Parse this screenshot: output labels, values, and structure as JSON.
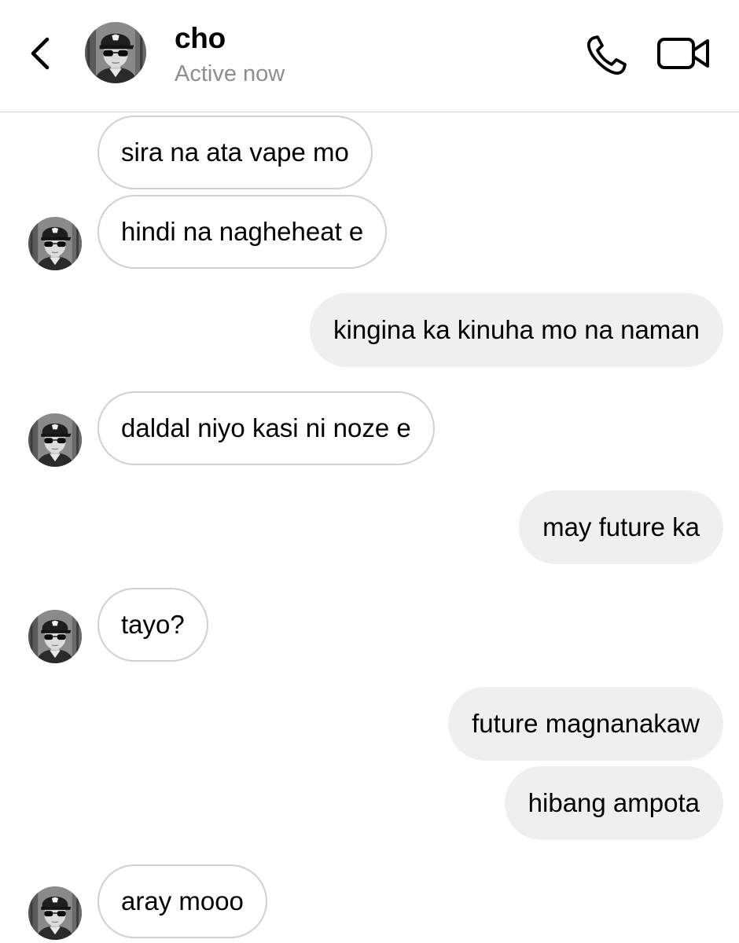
{
  "header": {
    "contact_name": "cho",
    "status": "Active now",
    "icons": {
      "back": "chevron-left-icon",
      "call": "phone-icon",
      "video": "video-camera-icon"
    }
  },
  "colors": {
    "incoming_border": "#d0d0d0",
    "outgoing_bg": "#efefef",
    "status_text": "#8e8e8e",
    "divider": "#d4d4d4"
  },
  "messages": [
    {
      "side": "in",
      "text": "sira na ata vape mo",
      "avatar": false
    },
    {
      "side": "in",
      "text": "hindi na nagheheat e",
      "avatar": true
    },
    {
      "side": "out",
      "text": "kingina ka kinuha mo na naman"
    },
    {
      "side": "in",
      "text": "daldal niyo kasi ni noze e",
      "avatar": true
    },
    {
      "side": "out",
      "text": "may future ka"
    },
    {
      "side": "in",
      "text": "tayo?",
      "avatar": true
    },
    {
      "side": "out",
      "text": "future magnanakaw"
    },
    {
      "side": "out",
      "text": "hibang ampota"
    },
    {
      "side": "in",
      "text": "aray mooo",
      "avatar": true
    }
  ]
}
